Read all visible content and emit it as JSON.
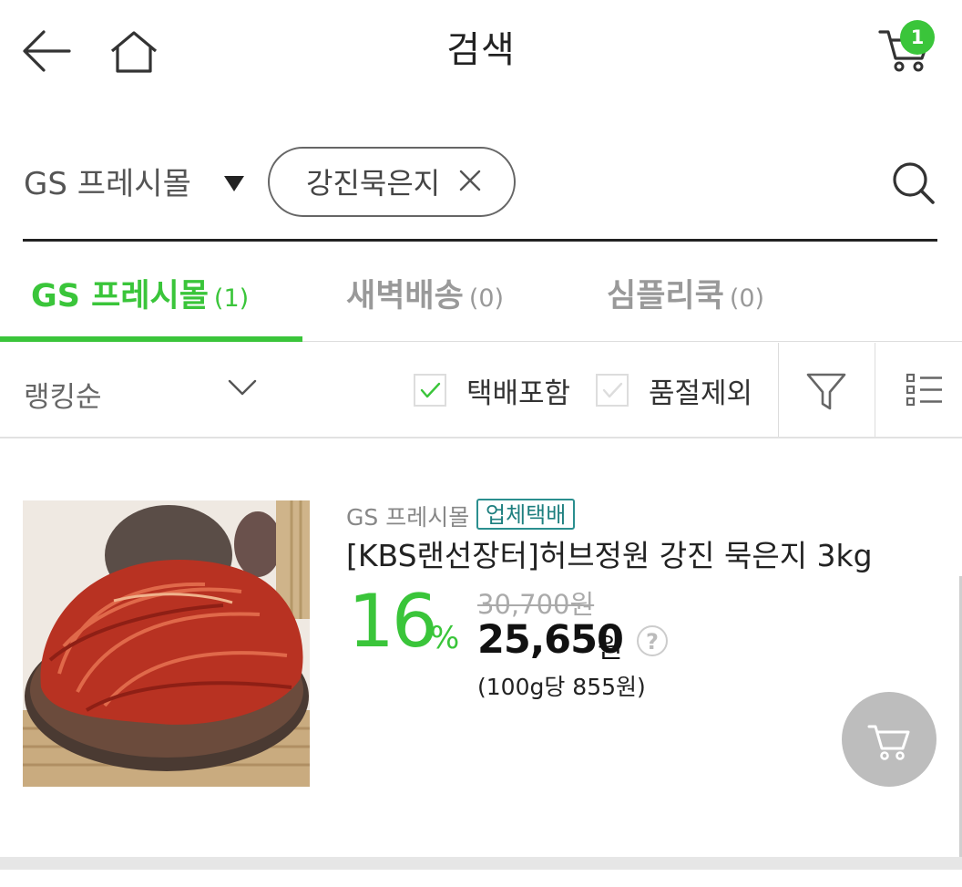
{
  "header": {
    "title": "검색",
    "back_icon": "back-arrow-icon",
    "home_icon": "home-icon",
    "cart_icon": "cart-icon",
    "cart_count": "1"
  },
  "search": {
    "mall_selected": "GS 프레시몰",
    "query_chip": "강진묵은지"
  },
  "tabs": [
    {
      "label": "GS 프레시몰",
      "count": "(1)",
      "active": true
    },
    {
      "label": "새벽배송",
      "count": "(0)",
      "active": false
    },
    {
      "label": "심플리쿡",
      "count": "(0)",
      "active": false
    }
  ],
  "filters": {
    "sort_label": "랭킹순",
    "delivery_included_label": "택배포함",
    "delivery_included_checked": true,
    "exclude_soldout_label": "품절제외",
    "exclude_soldout_checked": false
  },
  "product": {
    "mall": "GS 프레시몰",
    "badge": "업체택배",
    "name": "[KBS랜선장터]허브정원 강진 묵은지 3kg",
    "discount_rate": "16",
    "discount_unit": "%",
    "original_price": "30,700원",
    "price": "25,650",
    "price_unit": "원",
    "help": "?",
    "unit_price": "(100g당 855원)"
  },
  "colors": {
    "accent": "#3ac53a",
    "badge": "#2b8f8f"
  }
}
